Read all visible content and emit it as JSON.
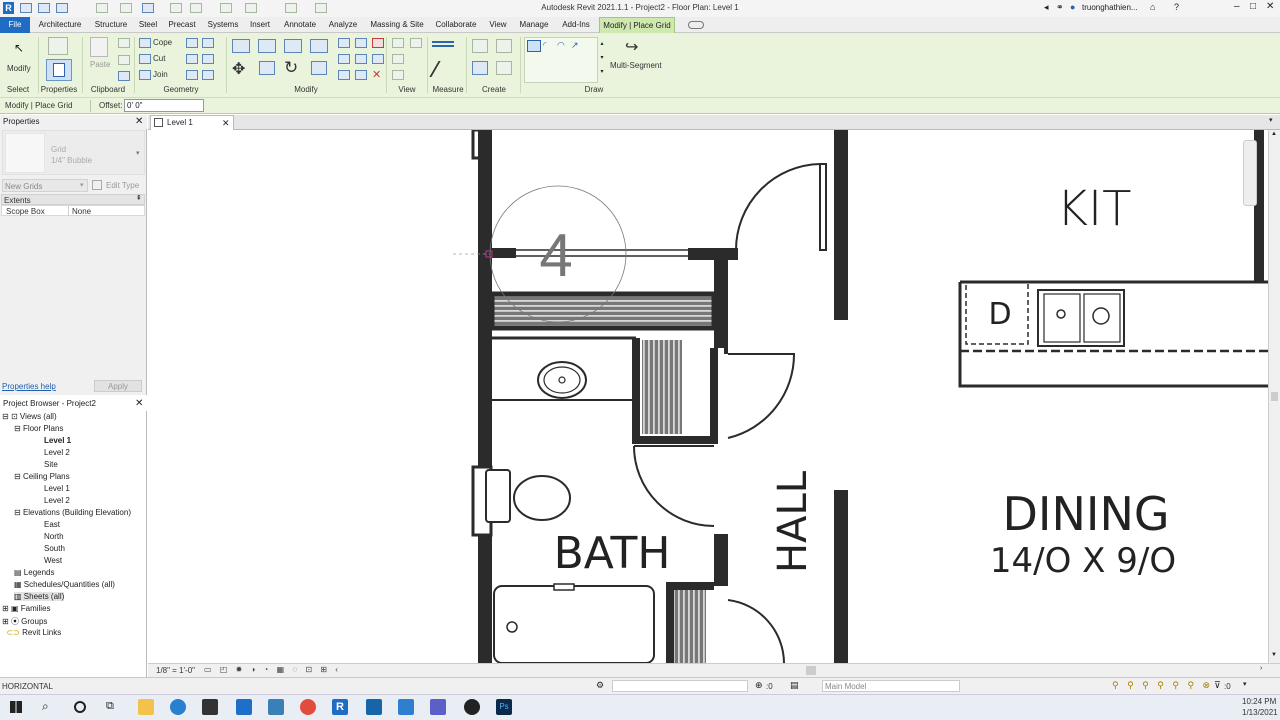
{
  "app": {
    "title": "Autodesk Revit 2021.1.1 - Project2 - Floor Plan: Level 1",
    "user": "truonghathien..."
  },
  "tabs": [
    "File",
    "Architecture",
    "Structure",
    "Steel",
    "Precast",
    "Systems",
    "Insert",
    "Annotate",
    "Analyze",
    "Massing & Site",
    "Collaborate",
    "View",
    "Manage",
    "Add-Ins",
    "Modify | Place Grid"
  ],
  "ribbon": {
    "modify_label": "Modify",
    "paste_label": "Paste",
    "cope_label": "Cope",
    "cut_label": "Cut",
    "join_label": "Join",
    "multi_segment_label": "Multi-Segment",
    "panels": {
      "select": "Select",
      "properties": "Properties",
      "clipboard": "Clipboard",
      "geometry": "Geometry",
      "modify": "Modify",
      "view": "View",
      "measure": "Measure",
      "create": "Create",
      "draw": "Draw"
    }
  },
  "options_bar": {
    "context": "Modify | Place Grid",
    "offset_label": "Offset:",
    "offset_value": "0'  0\""
  },
  "properties": {
    "title": "Properties",
    "type_name": "Grid",
    "type_sub": "1/4\" Bubble",
    "instance_filter": "New Grids",
    "edit_type": "Edit Type",
    "group": "Extents",
    "param_name": "Scope Box",
    "param_value": "None",
    "help_link": "Properties help",
    "apply": "Apply"
  },
  "project_browser": {
    "title": "Project Browser - Project2",
    "items": [
      "Views (all)",
      "Floor Plans",
      "Level 1",
      "Level 2",
      "Site",
      "Ceiling Plans",
      "Level 1",
      "Level 2",
      "Elevations (Building Elevation)",
      "East",
      "North",
      "South",
      "West",
      "Legends",
      "Schedules/Quantities (all)",
      "Sheets (all)",
      "Families",
      "Groups",
      "Revit Links"
    ]
  },
  "view_tab": "Level 1",
  "drawing": {
    "grid_label": "4",
    "rooms": [
      "KIT",
      "D",
      "BATH",
      "HALL",
      "DINING",
      "14/O X 9/O"
    ]
  },
  "view_control": {
    "scale": "1/8\" = 1'-0\""
  },
  "status": {
    "left": "HORIZONTAL",
    "worksets": ":0",
    "model": "Main Model",
    "filter": ":0"
  },
  "taskbar": {
    "time": "10:24 PM",
    "date": "1/13/2021"
  },
  "colors": {
    "ribbon_bg": "#eaf4dc",
    "file_tab": "#1f6cc5",
    "wall": "#2b2b2b"
  }
}
